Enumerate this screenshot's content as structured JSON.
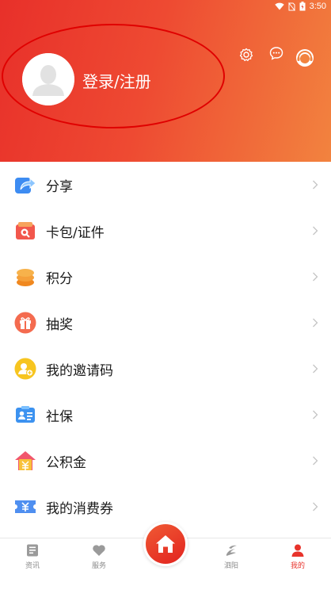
{
  "status_bar": {
    "time": "3:50"
  },
  "profile": {
    "login_label": "登录/注册"
  },
  "menu": {
    "items": [
      {
        "label": "分享",
        "icon": "share-icon"
      },
      {
        "label": "卡包/证件",
        "icon": "card-wallet-icon"
      },
      {
        "label": "积分",
        "icon": "points-coins-icon"
      },
      {
        "label": "抽奖",
        "icon": "gift-icon"
      },
      {
        "label": "我的邀请码",
        "icon": "invite-code-icon"
      },
      {
        "label": "社保",
        "icon": "social-security-icon"
      },
      {
        "label": "公积金",
        "icon": "housing-fund-icon"
      },
      {
        "label": "我的消费券",
        "icon": "coupon-icon"
      }
    ]
  },
  "tabbar": {
    "tabs": [
      {
        "label": "资讯",
        "icon": "news-icon"
      },
      {
        "label": "服务",
        "icon": "heart-icon"
      },
      {
        "label": "泗阳",
        "icon": "city-logo-icon"
      },
      {
        "label": "我的",
        "icon": "user-icon"
      }
    ],
    "home_icon": "home-icon"
  },
  "colors": {
    "accent": "#e8332b",
    "header_start": "#e8302a",
    "header_end": "#f2833f",
    "annotation": "#e00000"
  }
}
